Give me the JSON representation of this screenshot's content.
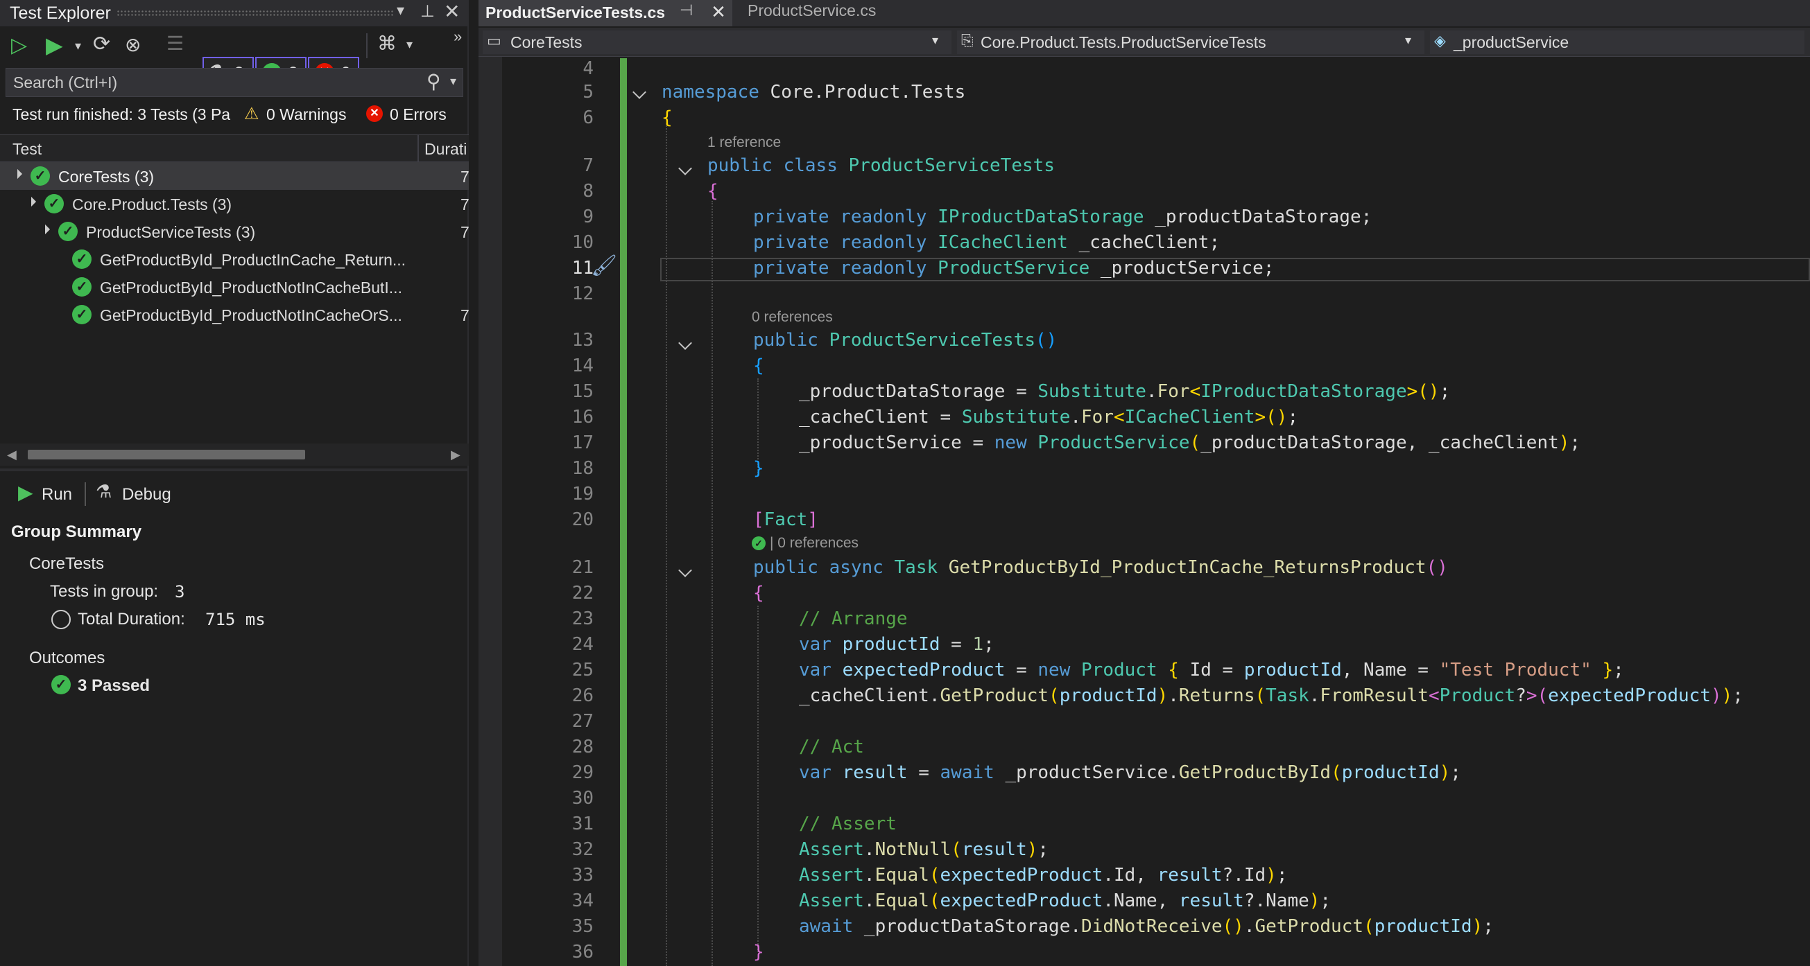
{
  "test_explorer": {
    "title": "Test Explorer",
    "counters": {
      "total": "3",
      "passed": "3",
      "failed": "0"
    },
    "search": {
      "placeholder": "Search (Ctrl+I)"
    },
    "status": {
      "summary": "Test run finished: 3 Tests (3 Pa",
      "warnings": "0 Warnings",
      "errors": "0 Errors"
    },
    "columns": {
      "test": "Test",
      "duration": "Durati"
    },
    "tree": [
      {
        "label": "CoreTests  (3)",
        "dur": "7"
      },
      {
        "label": "Core.Product.Tests  (3)",
        "dur": "7"
      },
      {
        "label": "ProductServiceTests  (3)",
        "dur": "7"
      },
      {
        "label": "GetProductById_ProductInCache_Return...",
        "dur": ""
      },
      {
        "label": "GetProductById_ProductNotInCacheButI...",
        "dur": ""
      },
      {
        "label": "GetProductById_ProductNotInCacheOrS...",
        "dur": "7"
      }
    ],
    "detail": {
      "run": "Run",
      "debug": "Debug",
      "group_summary": "Group Summary",
      "group_name": "CoreTests",
      "tests_in_group_label": "Tests in group:",
      "tests_in_group_value": "3",
      "total_duration_label": "Total Duration:",
      "total_duration_value": "715 ms",
      "outcomes": "Outcomes",
      "passed": "3 Passed"
    }
  },
  "editor": {
    "tabs": [
      {
        "label": "ProductServiceTests.cs",
        "active": true
      },
      {
        "label": "ProductService.cs",
        "active": false
      }
    ],
    "nav": {
      "project": "CoreTests",
      "type": "Core.Product.Tests.ProductServiceTests",
      "member": "_productService"
    },
    "line_numbers": [
      "4",
      "5",
      "6",
      "7",
      "8",
      "9",
      "10",
      "11",
      "12",
      "13",
      "14",
      "15",
      "16",
      "17",
      "18",
      "19",
      "20",
      "21",
      "22",
      "23",
      "24",
      "25",
      "26",
      "27",
      "28",
      "29",
      "30",
      "31",
      "32",
      "33",
      "34",
      "35",
      "36"
    ],
    "lens": {
      "class_refs": "1 reference",
      "ctor_refs": "0 references",
      "test_refs": "| 0 references"
    }
  },
  "colors": {
    "accent": "#7160e8",
    "pass": "#3fb950",
    "fail": "#e51400",
    "change_bar": "#57a64a"
  }
}
